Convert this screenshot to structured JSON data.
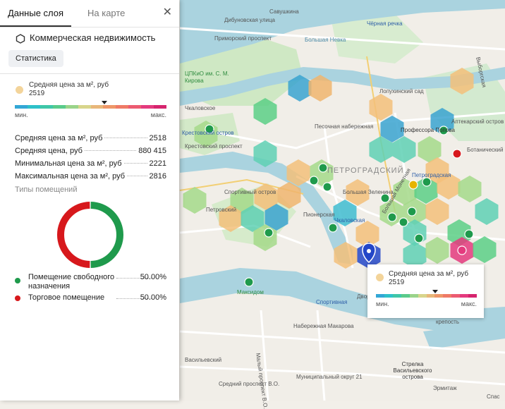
{
  "tabs": {
    "active": "Данные слоя",
    "inactive": "На карте"
  },
  "layer": {
    "title": "Коммерческая недвижимость",
    "stats_button": "Статистика"
  },
  "legend": {
    "label": "Средняя цена за м², руб",
    "value": "2519",
    "min_label": "мин.",
    "max_label": "макс.",
    "marker_fraction": 0.59,
    "scale_colors": [
      "#33a7d6",
      "#2ec1c9",
      "#3fc7a8",
      "#5acb8b",
      "#9ad48a",
      "#d8d58c",
      "#e8b77a",
      "#ee9768",
      "#ef7a66",
      "#ec5b71",
      "#e43a7e",
      "#d6246e"
    ]
  },
  "stats": [
    {
      "label": "Средняя цена за м², руб",
      "value": "2518"
    },
    {
      "label": "Средняя цена, руб",
      "value": "880 415"
    },
    {
      "label": "Минимальная цена за м², руб",
      "value": "2221"
    },
    {
      "label": "Максимальная цена за м², руб",
      "value": "2816"
    }
  ],
  "room_types": {
    "title": "Типы помещений",
    "items": [
      {
        "label": "Помещение свободного назначения",
        "value": "50.00%",
        "share": 0.5,
        "color": "#1f9a4c"
      },
      {
        "label": "Торговое помещение",
        "value": "50.00%",
        "share": 0.5,
        "color": "#d7181c"
      }
    ]
  },
  "map": {
    "places": [
      "Дибуновская улица",
      "Савушкина",
      "Чёрная речка",
      "Приморский проспект",
      "Большая Невка",
      "ЦПКиО им. С. М. Кирова",
      "Лопухинский сад",
      "Чкаловское",
      "Крестовский остров",
      "Крестовский проспект",
      "Песочная набережная",
      "Профессора Попова",
      "Аптекарский остров",
      "Ботанический",
      "ПЕТРОГРАДСКИЙ",
      "Петроградская",
      "Спортивный остров",
      "Петровский",
      "Чкаловская",
      "Пионерская",
      "Большая Зеленина",
      "Спортивная",
      "Максидом",
      "Набережная Макарова",
      "крепость",
      "Васильевский",
      "Муниципальный округ 21",
      "Стрелка Васильевского острова",
      "Эрмитаж",
      "Спас",
      "Малый проспект В.О.",
      "Средний проспект В.О.",
      "Выборгская",
      "Большая Монетная",
      "Дворцовая"
    ]
  }
}
